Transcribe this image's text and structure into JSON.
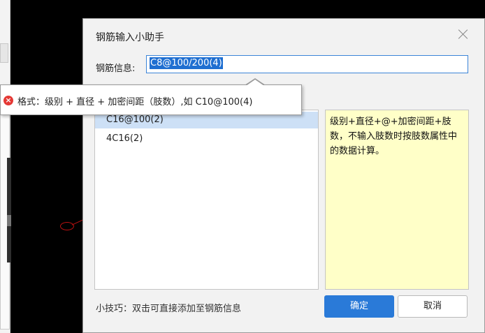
{
  "dialog": {
    "title": "钢筋输入小助手",
    "info_label": "钢筋信息:",
    "info_value": "C8@100/200(4)",
    "list_items": [
      "C16@100(2)",
      "4C16(2)"
    ],
    "description": "级别+直径+@+加密间距+肢数，不输入肢数时按肢数属性中的数据计算。",
    "tip": "小技巧：双击可直接添加至钢筋信息",
    "ok_label": "确定",
    "cancel_label": "取消"
  },
  "tooltip": {
    "icon": "error-icon",
    "text": "格式：级别 + 直径 + 加密间距（肢数）,如 C10@100(4)"
  },
  "colors": {
    "accent": "#2a7ad8",
    "selection": "#1f6fd1",
    "description_bg": "#ffffc8",
    "error": "#e53935"
  }
}
